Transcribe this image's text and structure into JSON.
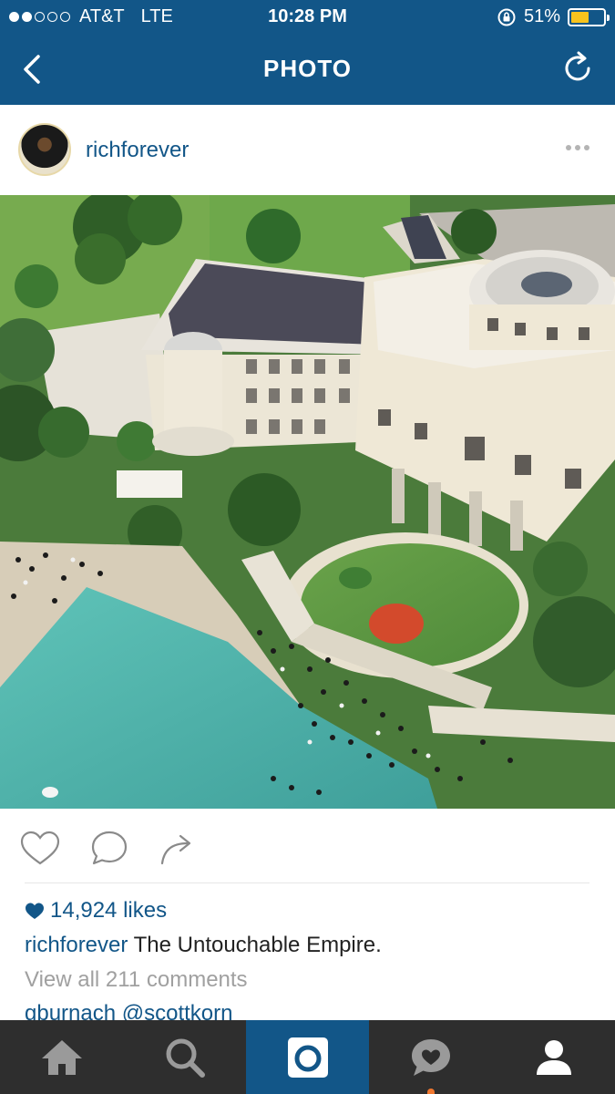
{
  "status_bar": {
    "carrier": "AT&T",
    "network": "LTE",
    "time": "10:28 PM",
    "battery_percent": "51%",
    "signal_bars_filled": 2,
    "signal_bars_total": 5,
    "battery_level": 0.51,
    "battery_color": "#f7c31d"
  },
  "nav": {
    "title": "PHOTO",
    "back_icon": "chevron-left-icon",
    "refresh_icon": "refresh-icon",
    "bg_color": "#125688"
  },
  "post": {
    "username": "richforever",
    "avatar_icon": "avatar",
    "more_icon": "ellipsis-icon",
    "photo_description_icon": "mansion-photo",
    "actions": {
      "like_icon": "heart-outline-icon",
      "comment_icon": "speech-bubble-icon",
      "share_icon": "share-arrow-icon"
    },
    "likes": "14,924 likes",
    "caption_user": "richforever",
    "caption_text": "The Untouchable Empire.",
    "view_all_comments": "View all 211 comments",
    "comment_peek": "gburnach @scottkorn"
  },
  "tabbar": {
    "tabs": [
      {
        "icon": "home-icon",
        "active": false
      },
      {
        "icon": "search-icon",
        "active": false
      },
      {
        "icon": "camera-icon",
        "active": true
      },
      {
        "icon": "activity-heart-bubble-icon",
        "active": false,
        "notification": true
      },
      {
        "icon": "profile-icon",
        "active": false
      }
    ],
    "active_color": "#125688",
    "notification_color": "#f0772f"
  }
}
